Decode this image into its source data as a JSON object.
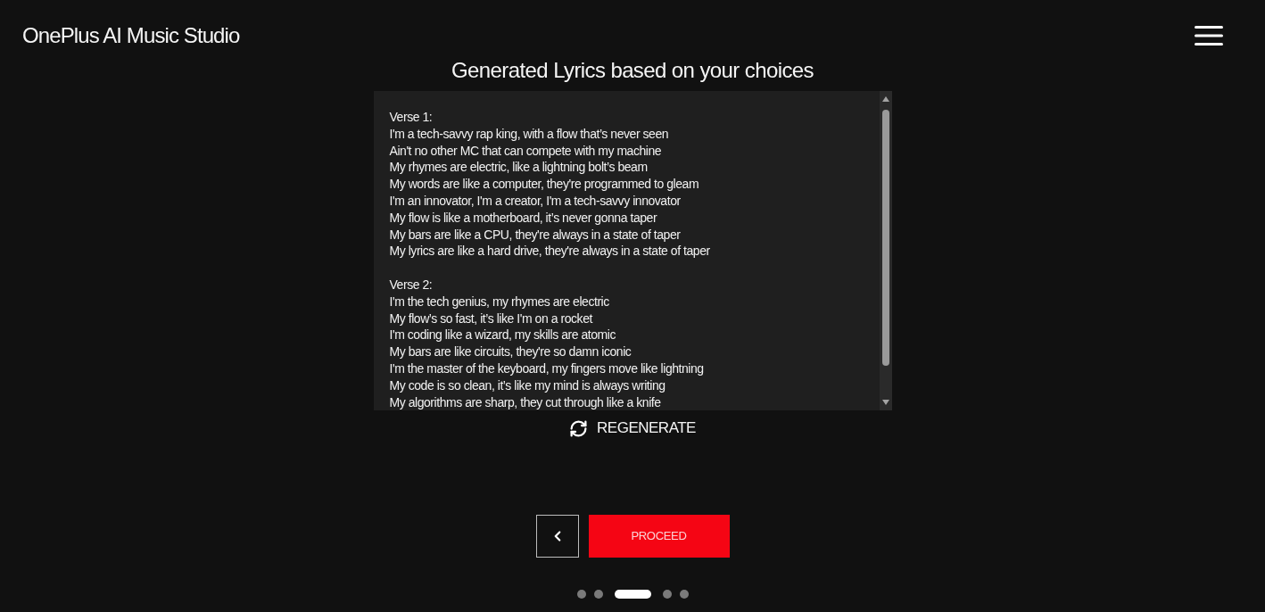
{
  "header": {
    "title": "OnePlus AI Music Studio"
  },
  "heading": "Generated Lyrics based on your choices",
  "lyrics": {
    "verses": [
      {
        "heading": "Verse 1:",
        "lines": [
          "I'm a tech-savvy rap king, with a flow that’s never seen",
          "Ain't no other MC that can compete with my machine",
          "My rhymes are electric, like a lightning bolt’s beam",
          "My words are like a computer, they're programmed to gleam",
          "I'm an innovator, I'm a creator, I'm a tech-savvy innovator",
          "My flow is like a motherboard, it’s never gonna taper",
          "My bars are like a CPU, they're always in a state of taper",
          "My lyrics are like a hard drive, they're always in a state of taper"
        ]
      },
      {
        "heading": "Verse 2:",
        "lines": [
          "I'm the tech genius, my rhymes are electric",
          "My flow’s so fast, it’s like I'm on a rocket",
          "I'm coding like a wizard, my skills are atomic",
          "My bars are like circuits, they're so damn iconic",
          "I'm the master of the keyboard, my fingers move like lightning",
          "My code is so clean, it’s like my mind is always writing",
          "My algorithms are sharp, they cut through like a knife"
        ]
      }
    ]
  },
  "regenerate_button": {
    "label": "REGENERATE"
  },
  "navigation": {
    "proceed_button": {
      "label": "PROCEED"
    }
  },
  "steps": [
    {
      "selected": false
    },
    {
      "selected": false
    },
    {
      "selected": true
    },
    {
      "selected": false
    },
    {
      "selected": false
    }
  ]
}
